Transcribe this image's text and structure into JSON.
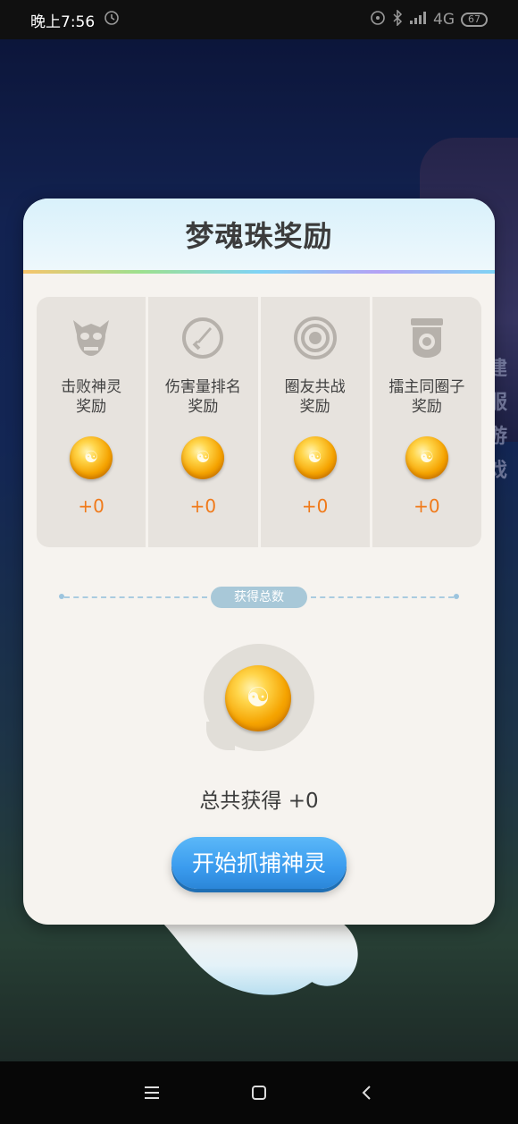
{
  "status_bar": {
    "time": "晚上7:56",
    "network": "4G",
    "battery": "67"
  },
  "background": {
    "side_text": "建服游戏"
  },
  "dialog": {
    "title": "梦魂珠奖励",
    "rewards": [
      {
        "icon": "demon-mask-icon",
        "label_line1": "击败神灵",
        "label_line2": "奖励",
        "value": "+0"
      },
      {
        "icon": "sword-icon",
        "label_line1": "伤害量排名",
        "label_line2": "奖励",
        "value": "+0"
      },
      {
        "icon": "target-circle-icon",
        "label_line1": "圈友共战",
        "label_line2": "奖励",
        "value": "+0"
      },
      {
        "icon": "shield-badge-icon",
        "label_line1": "擂主同圈子",
        "label_line2": "奖励",
        "value": "+0"
      }
    ],
    "total_label": "获得总数",
    "total_text": "总共获得 +0",
    "start_button": "开始抓捕神灵"
  },
  "colors": {
    "accent_orange": "#f07a1a",
    "button_blue": "#3a9bee",
    "card_bg": "#f6f3ef"
  }
}
